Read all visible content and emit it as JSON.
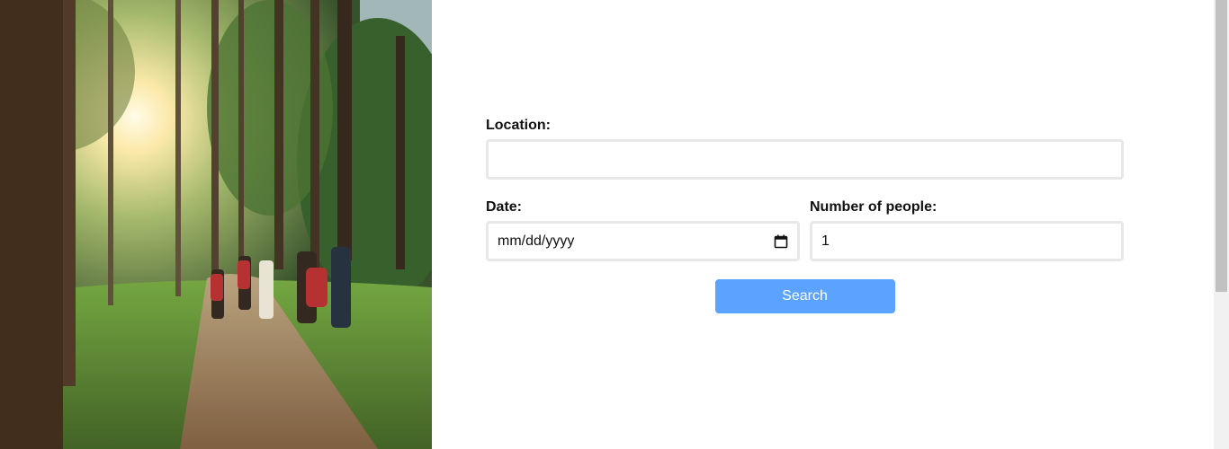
{
  "hero": {
    "image": "hikers-on-forest-trail"
  },
  "form": {
    "location": {
      "label": "Location:",
      "value": "",
      "placeholder": ""
    },
    "date": {
      "label": "Date:",
      "placeholder": "mm/dd/yyyy",
      "icon": "calendar-icon"
    },
    "people": {
      "label": "Number of people:",
      "value": "1"
    },
    "search_label": "Search"
  },
  "colors": {
    "button": "#5ba3ff",
    "field_border": "#e8e8e8"
  }
}
